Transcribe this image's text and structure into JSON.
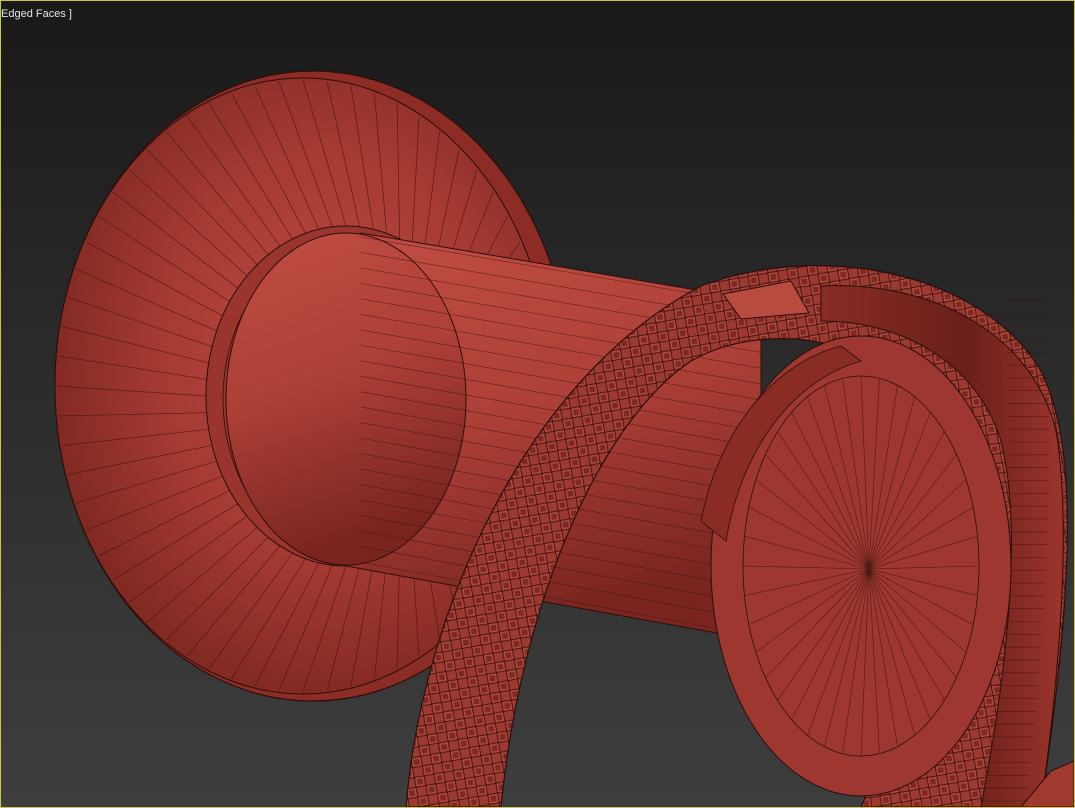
{
  "viewport": {
    "label": "Edged Faces ]",
    "border_color": "#c9c84a",
    "background_top": "#191919",
    "background_bottom": "#3e3e3e"
  },
  "scene": {
    "object": "spool-with-knurled-ring",
    "material_color": "#a9433a",
    "edge_color": "#2a0e0b",
    "shading": "edged-faces"
  }
}
